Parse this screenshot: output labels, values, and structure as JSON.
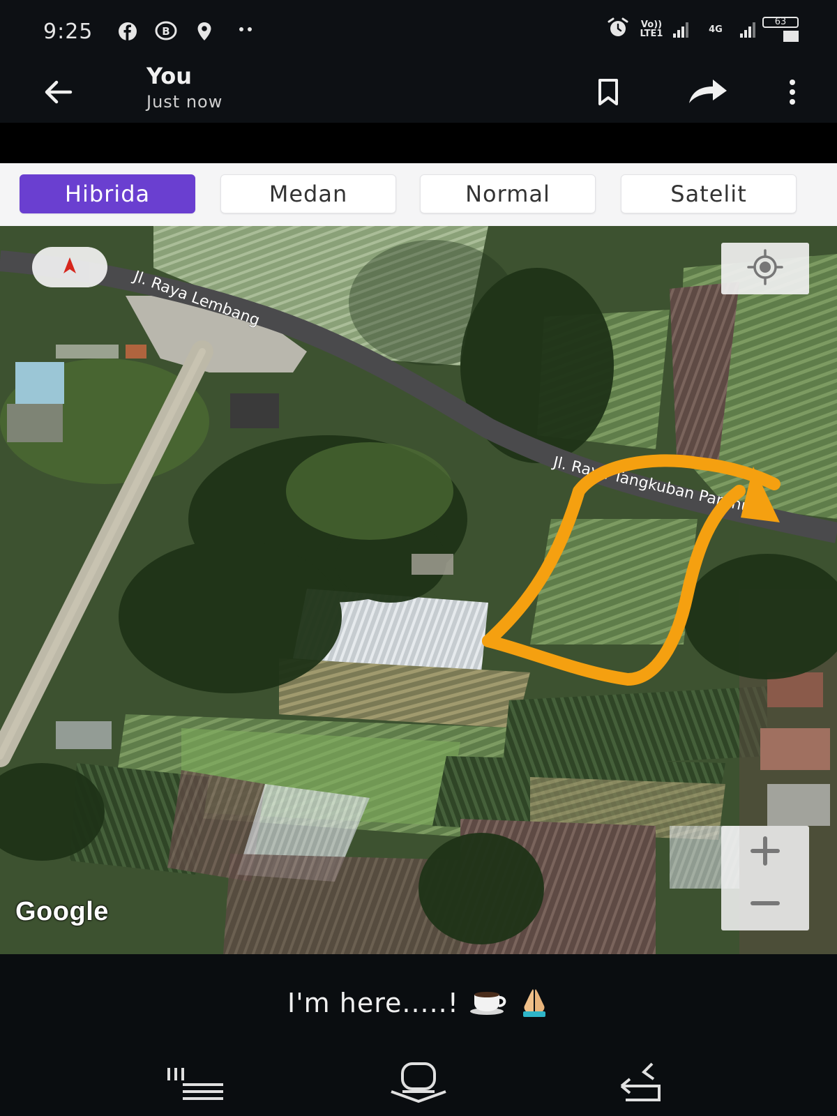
{
  "status_bar": {
    "time": "9:25",
    "left_icons": [
      "facebook-icon",
      "messenger-bot-icon",
      "location-pin-icon",
      "more-dots-icon"
    ],
    "network_1": "Vo)) LTE1",
    "network_2": "4G",
    "battery": "63"
  },
  "header": {
    "title": "You",
    "subtitle": "Just now"
  },
  "map_tabs": [
    {
      "label": "Hibrida",
      "active": true
    },
    {
      "label": "Medan",
      "active": false
    },
    {
      "label": "Normal",
      "active": false
    },
    {
      "label": "Satelit",
      "active": false
    }
  ],
  "map": {
    "road_1": "Jl. Raya Lembang",
    "road_2": "Jl. Raya Tangkuban Parahu",
    "attribution": "Google",
    "annotation_color": "#f5a010"
  },
  "caption": {
    "text": "I'm here.....!"
  },
  "colors": {
    "accent": "#6a3fd0",
    "background": "#0a0d10"
  }
}
